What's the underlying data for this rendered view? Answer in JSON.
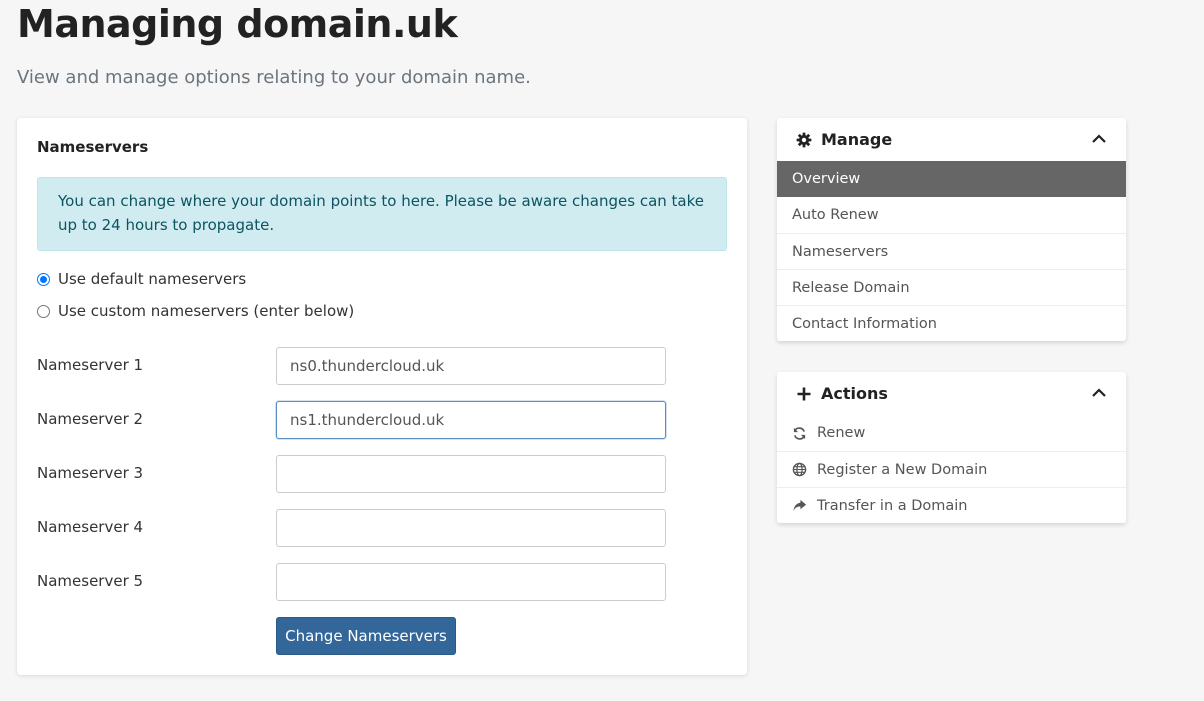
{
  "page": {
    "title": "Managing domain.uk",
    "subtitle": "View and manage options relating to your domain name."
  },
  "nameservers_card": {
    "title": "Nameservers",
    "alert": "You can change where your domain points to here. Please be aware changes can take up to 24 hours to propagate.",
    "radio_default_label": "Use default nameservers",
    "radio_custom_label": "Use custom nameservers (enter below)",
    "selected_option": "default",
    "fields": [
      {
        "label": "Nameserver 1",
        "value": "ns0.thundercloud.uk"
      },
      {
        "label": "Nameserver 2",
        "value": "ns1.thundercloud.uk"
      },
      {
        "label": "Nameserver 3",
        "value": ""
      },
      {
        "label": "Nameserver 4",
        "value": ""
      },
      {
        "label": "Nameserver 5",
        "value": ""
      }
    ],
    "submit_label": "Change Nameservers"
  },
  "manage_panel": {
    "title": "Manage",
    "icon": "gear-icon",
    "items": [
      {
        "label": "Overview",
        "active": true
      },
      {
        "label": "Auto Renew"
      },
      {
        "label": "Nameservers"
      },
      {
        "label": "Release Domain"
      },
      {
        "label": "Contact Information"
      }
    ]
  },
  "actions_panel": {
    "title": "Actions",
    "icon": "plus-icon",
    "items": [
      {
        "label": "Renew",
        "icon": "refresh-icon"
      },
      {
        "label": "Register a New Domain",
        "icon": "globe-icon"
      },
      {
        "label": "Transfer in a Domain",
        "icon": "share-arrow-icon"
      }
    ]
  },
  "colors": {
    "accent": "#336699",
    "active_item_bg": "#666666",
    "alert_bg": "#d1ecf1"
  }
}
